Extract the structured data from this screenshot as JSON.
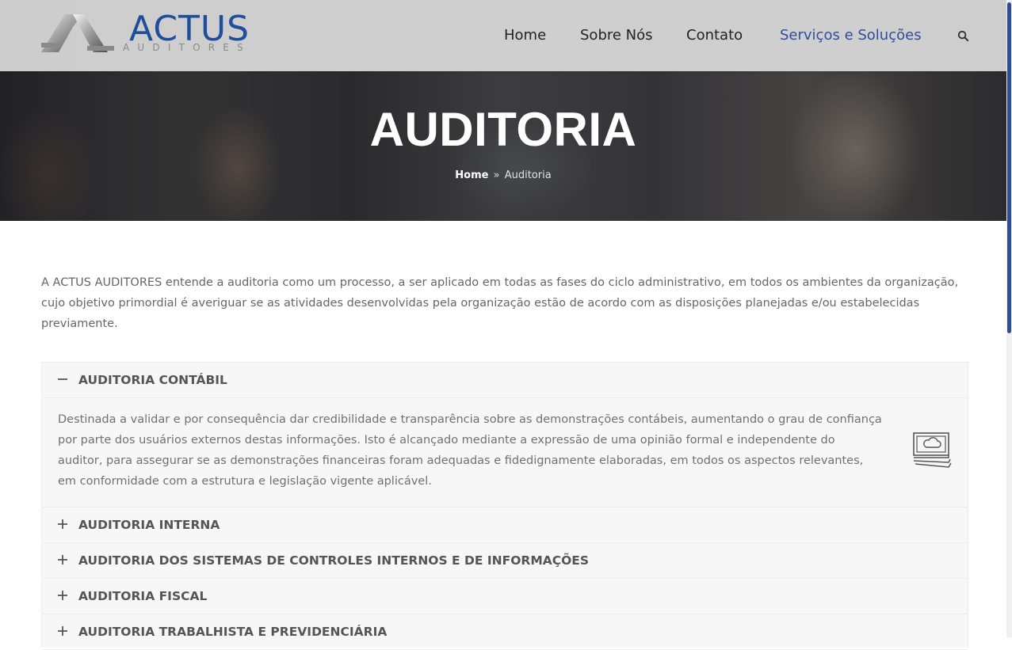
{
  "header": {
    "logo": {
      "main": "ACTUS",
      "sub": "AUDITORES"
    },
    "nav": [
      {
        "label": "Home"
      },
      {
        "label": "Sobre Nós"
      },
      {
        "label": "Contato"
      },
      {
        "label": "Serviços e Soluções",
        "active": true
      }
    ],
    "search_icon": "search-icon",
    "accent_color": "#2d4e9b"
  },
  "hero": {
    "title": "AUDITORIA",
    "breadcrumb": {
      "home": "Home",
      "separator": "»",
      "current": "Auditoria"
    }
  },
  "intro": "A ACTUS AUDITORES entende a auditoria como um processo, a ser aplicado em todas as fases do ciclo administrativo, em todos os ambientes da organização, cujo objetivo primordial é averiguar se as atividades desenvolvidas pela organização estão de acordo com as disposições planejadas e/ou estabelecidas previamente.",
  "accordion": [
    {
      "title": "AUDITORIA CONTÁBIL",
      "expanded": true,
      "text": "Destinada a validar e por consequência dar credibilidade e transparência sobre as demonstrações contábeis, aumentando o grau de confiança por parte dos usuários externos destas informações. Isto é alcançado mediante a expressão de uma opinião formal e independente do auditor, para assegurar se as demonstrações financeiras foram adequadas e fidedignamente elaboradas, em todos os aspectos relevantes, em conformidade com a estrutura e legislação vigente aplicável.",
      "icon": "money-bills-icon"
    },
    {
      "title": "AUDITORIA INTERNA",
      "expanded": false
    },
    {
      "title": "AUDITORIA DOS SISTEMAS DE CONTROLES INTERNOS E DE INFORMAÇÕES",
      "expanded": false
    },
    {
      "title": "AUDITORIA FISCAL",
      "expanded": false
    },
    {
      "title": "AUDITORIA TRABALHISTA E PREVIDENCIÁRIA",
      "expanded": false
    }
  ]
}
